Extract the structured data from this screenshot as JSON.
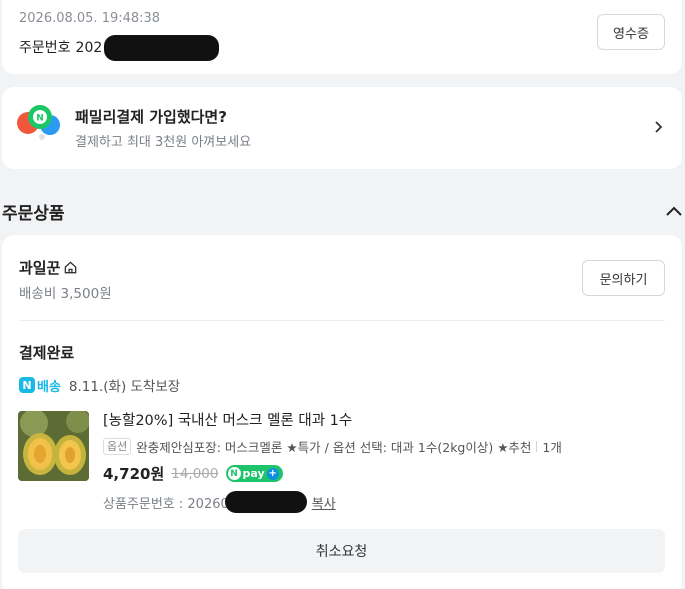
{
  "order": {
    "datetime": "2026.08.05. 19:48:38",
    "number_label": "주문번호",
    "number_visible": "202",
    "receipt_label": "영수증"
  },
  "promo": {
    "title": "패밀리결제 가입했다면?",
    "subtitle": "결제하고 최대 3천원 아껴보세요",
    "icon_n": "N"
  },
  "section": {
    "title": "주문상품"
  },
  "store": {
    "name": "과일꾼",
    "shipping_fee": "배송비 3,500원",
    "inquiry_label": "문의하기"
  },
  "order_status": "결제완료",
  "delivery": {
    "badge_n": "N",
    "badge_label": "배송",
    "guarantee": "8.11.(화) 도착보장"
  },
  "product": {
    "name": "[농할20%] 국내산 머스크 멜론 대과 1수",
    "option_tag": "옵션",
    "option_text": "완충제안심포장: 머스크멜론 ★특가 / 옵션 선택: 대과 1수(2kg이상) ★추천",
    "quantity": "1개",
    "price": "4,720원",
    "original_price": "14,000",
    "npay_n": "N",
    "npay_label": "pay",
    "npay_plus": "+",
    "item_no_label": "상품주문번호 : 20260",
    "copy_label": "복사"
  },
  "cancel_label": "취소요청",
  "colors": {
    "background": "#f1f3f5",
    "naver_blue": "#18b9e6",
    "npay_green": "#1ec46b"
  }
}
